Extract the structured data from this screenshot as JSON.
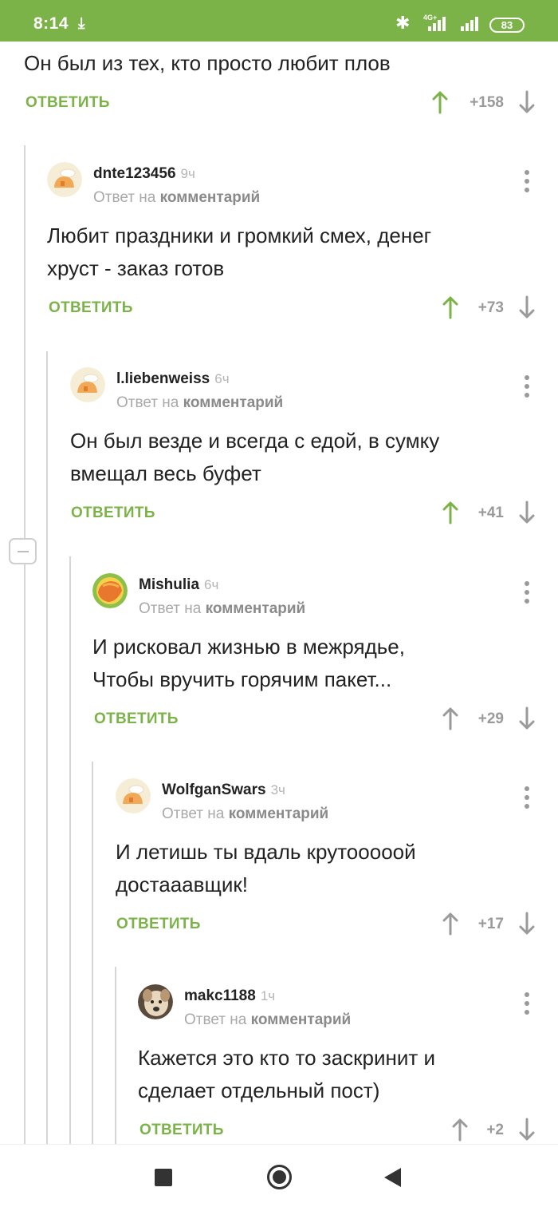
{
  "status_bar": {
    "time": "8:14",
    "network": "4G+",
    "battery": "83"
  },
  "top_comment": {
    "text": "Он был из тех, кто просто любит плов",
    "reply_label": "ОТВЕТИТЬ",
    "score": "+158"
  },
  "comments": [
    {
      "author": "dnte123456",
      "ago": "9ч",
      "reply_prefix": "Ответ на",
      "reply_target": "комментарий",
      "text": "Любит праздники и громкий смех, денег\nхруст - заказ готов",
      "reply_label": "ОТВЕТИТЬ",
      "score": "+73"
    },
    {
      "author": "l.liebenweiss",
      "ago": "6ч",
      "reply_prefix": "Ответ на",
      "reply_target": "комментарий",
      "text": "Он был везде и всегда с едой, в сумку\nвмещал весь буфет",
      "reply_label": "ОТВЕТИТЬ",
      "score": "+41"
    },
    {
      "author": "Mishulia",
      "ago": "6ч",
      "reply_prefix": "Ответ на",
      "reply_target": "комментарий",
      "text": "И рисковал жизнью в межрядье,\n Чтобы вручить горячим пакет...",
      "reply_label": "ОТВЕТИТЬ",
      "score": "+29"
    },
    {
      "author": "WolfganSwars",
      "ago": "3ч",
      "reply_prefix": "Ответ на",
      "reply_target": "комментарий",
      "text": "И летишь ты вдаль крутооооой\nдостааавщик!",
      "reply_label": "ОТВЕТИТЬ",
      "score": "+17"
    },
    {
      "author": "makc1188",
      "ago": "1ч",
      "reply_prefix": "Ответ на",
      "reply_target": "комментарий",
      "text": "Кажется это кто то заскринит и\nсделает отдельный пост)",
      "reply_label": "ОТВЕТИТЬ",
      "score": "+2"
    }
  ],
  "colors": {
    "accent": "#7bb348",
    "upvoted": "#7bb348",
    "neutral": "#9a9a9a"
  }
}
